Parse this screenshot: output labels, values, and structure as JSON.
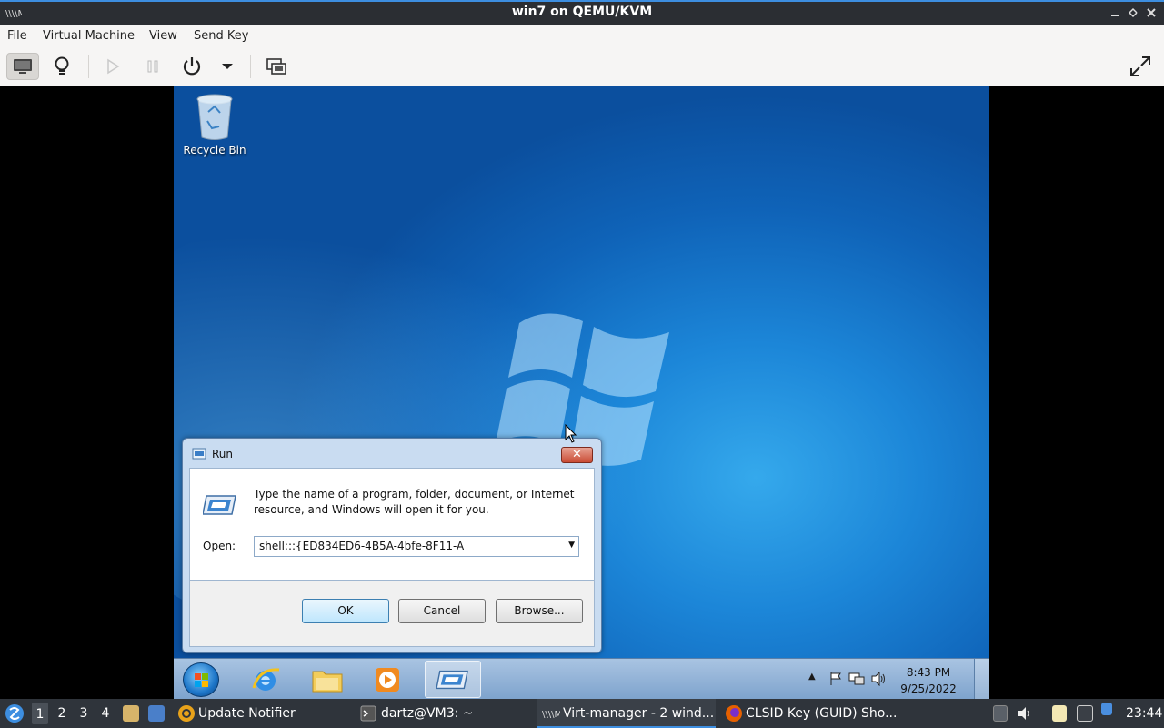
{
  "window": {
    "title": "win7 on QEMU/KVM",
    "app_icon": "virt-manager-icon",
    "controls": [
      "minimize-icon",
      "maximize-icon",
      "close-icon"
    ]
  },
  "menu": {
    "items": [
      "File",
      "Virtual Machine",
      "View",
      "Send Key"
    ]
  },
  "toolbar": {
    "buttons": [
      "console-icon",
      "details-lightbulb-icon",
      "run-play-icon",
      "pause-icon",
      "power-icon",
      "dropdown-icon",
      "snapshots-icon",
      "fullscreen-icon"
    ]
  },
  "desktop": {
    "icons": [
      {
        "label": "Recycle Bin",
        "icon": "recycle-bin-icon"
      }
    ]
  },
  "run_dialog": {
    "title": "Run",
    "description": "Type the name of a program, folder, document, or Internet resource, and Windows will open it for you.",
    "open_label": "Open:",
    "open_value": "shell:::{ED834ED6-4B5A-4bfe-8F11-A",
    "ok_label": "OK",
    "cancel_label": "Cancel",
    "browse_label": "Browse...",
    "close_glyph": "✕"
  },
  "win7_taskbar": {
    "pinned": [
      "ie-icon",
      "explorer-folder-icon",
      "media-player-icon",
      "run-window-icon"
    ],
    "time": "8:43 PM",
    "date": "9/25/2022",
    "tray_icons": [
      "show-hidden-icon",
      "action-center-flag-icon",
      "network-icon",
      "volume-icon"
    ]
  },
  "host_taskbar": {
    "workspaces": [
      "1",
      "2",
      "3",
      "4"
    ],
    "active_workspace": "1",
    "tasks": [
      {
        "label": "Update Notifier",
        "icon": "update-notifier-icon"
      },
      {
        "label": "dartz@VM3: ~",
        "icon": "terminal-icon"
      },
      {
        "label": "Virt-manager - 2 wind...",
        "icon": "virt-manager-icon"
      },
      {
        "label": "CLSID Key (GUID) Sho...",
        "icon": "firefox-icon"
      }
    ],
    "clock": "23:44"
  },
  "colors": {
    "accent": "#3d8ee0",
    "host_panel": "#2f343b",
    "win7_desktop": "#1c86d8"
  }
}
